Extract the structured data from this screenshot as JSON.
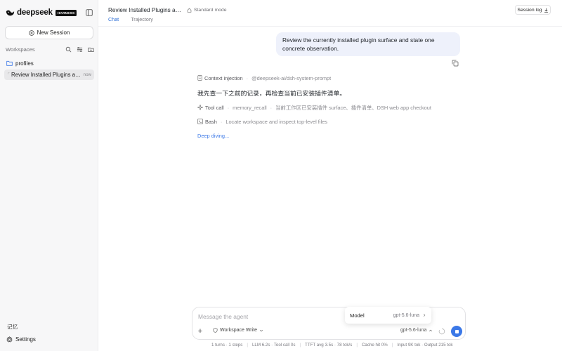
{
  "sidebar": {
    "brand_name": "deepseek",
    "brand_badge": "HARNESS",
    "new_session_label": "New Session",
    "workspaces_label": "Workspaces",
    "folder_label": "profiles",
    "session_title": "Review Installed Plugins and...",
    "session_time": "now",
    "memory_label": "记忆",
    "settings_label": "Settings"
  },
  "header": {
    "chat_title": "Review Installed Plugins and ...",
    "mode_label": "Standard mode",
    "session_log_label": "Session log",
    "tabs": [
      {
        "label": "Chat",
        "active": true
      },
      {
        "label": "Trajectory",
        "active": false
      }
    ]
  },
  "conversation": {
    "user_message": "Review the currently installed plugin surface and state one concrete observation.",
    "steps": {
      "context": {
        "label": "Context injection",
        "detail": "@deepseek-ai/dsh-system-prompt"
      },
      "thought": "我先查一下之前的记录，再检查当前已安装插件清单。",
      "tool": {
        "label": "Tool call",
        "name": "memory_recall",
        "detail": "当前工作区已安装插件 surface、插件清单、DSH web app checkout"
      },
      "bash": {
        "label": "Bash",
        "detail": "Locate workspace and inspect top-level files"
      }
    },
    "status": "Deep diving..."
  },
  "composer": {
    "placeholder": "Message the agent",
    "workspace_mode": "Workspace Write",
    "model": "gpt-5.6-luna"
  },
  "model_popup": {
    "label": "Model",
    "value": "gpt-5.6-luna"
  },
  "stats": [
    "1 turns · 1 steps",
    "LLM 6.2s · Tool call 0s",
    "TTFT avg 3.5s · 78 tok/s",
    "Cache hit 0%",
    "Input 9K tok · Output 215 tok"
  ],
  "colors": {
    "accent": "#3b78e7",
    "user_bubble": "#eef1fb",
    "sidebar_bg": "#f7f7f8"
  }
}
